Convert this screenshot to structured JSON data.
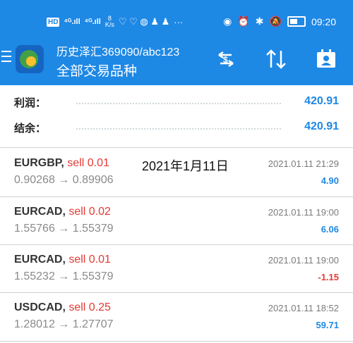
{
  "status_bar": {
    "hd": "HD",
    "sig1": "⁴ᴳ.ıll",
    "sig2": "⁴ᴳ.ıll",
    "speed_value": "8",
    "speed_unit": "K/s",
    "dots": "···",
    "time": "09:20"
  },
  "header": {
    "account": "历史泽汇369090/abc123",
    "subtitle": "全部交易品种"
  },
  "summary": {
    "profit_label": "利润：",
    "profit_value": "420.91",
    "balance_label": "结余：",
    "balance_value": "420.91"
  },
  "overlay_date": "2021年1月11日",
  "deals": [
    {
      "symbol": "EURGBP,",
      "side": " sell 0.01",
      "prices": "0.90268 → 0.89906",
      "time": "2021.01.11 21:29",
      "profit": "4.90",
      "color": "#1e88e5"
    },
    {
      "symbol": "EURCAD,",
      "side": " sell 0.02",
      "prices": "1.55766 → 1.55379",
      "time": "2021.01.11 19:00",
      "profit": "6.06",
      "color": "#1e88e5"
    },
    {
      "symbol": "EURCAD,",
      "side": " sell 0.01",
      "prices": "1.55232 → 1.55379",
      "time": "2021.01.11 19:00",
      "profit": "-1.15",
      "color": "#e53935"
    },
    {
      "symbol": "USDCAD,",
      "side": " sell 0.25",
      "prices": "1.28012 → 1.27707",
      "time": "2021.01.11 18:52",
      "profit": "59.71",
      "color": "#1e88e5"
    }
  ],
  "icons": {
    "menu": "hamburger-icon",
    "currency": "currency-exchange-icon",
    "sort": "sort-arrows-icon",
    "account": "account-card-icon"
  }
}
